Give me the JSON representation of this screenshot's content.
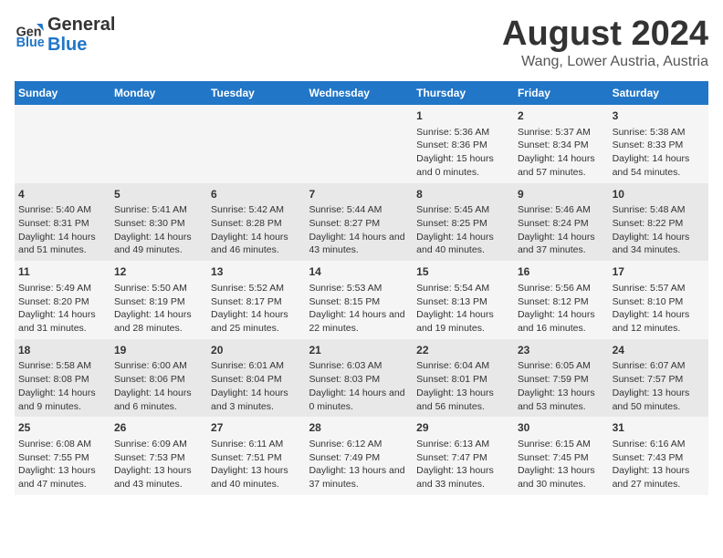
{
  "logo": {
    "line1": "General",
    "line2": "Blue"
  },
  "title": "August 2024",
  "subtitle": "Wang, Lower Austria, Austria",
  "days_of_week": [
    "Sunday",
    "Monday",
    "Tuesday",
    "Wednesday",
    "Thursday",
    "Friday",
    "Saturday"
  ],
  "weeks": [
    [
      {
        "day": "",
        "detail": ""
      },
      {
        "day": "",
        "detail": ""
      },
      {
        "day": "",
        "detail": ""
      },
      {
        "day": "",
        "detail": ""
      },
      {
        "day": "1",
        "detail": "Sunrise: 5:36 AM\nSunset: 8:36 PM\nDaylight: 15 hours and 0 minutes."
      },
      {
        "day": "2",
        "detail": "Sunrise: 5:37 AM\nSunset: 8:34 PM\nDaylight: 14 hours and 57 minutes."
      },
      {
        "day": "3",
        "detail": "Sunrise: 5:38 AM\nSunset: 8:33 PM\nDaylight: 14 hours and 54 minutes."
      }
    ],
    [
      {
        "day": "4",
        "detail": "Sunrise: 5:40 AM\nSunset: 8:31 PM\nDaylight: 14 hours and 51 minutes."
      },
      {
        "day": "5",
        "detail": "Sunrise: 5:41 AM\nSunset: 8:30 PM\nDaylight: 14 hours and 49 minutes."
      },
      {
        "day": "6",
        "detail": "Sunrise: 5:42 AM\nSunset: 8:28 PM\nDaylight: 14 hours and 46 minutes."
      },
      {
        "day": "7",
        "detail": "Sunrise: 5:44 AM\nSunset: 8:27 PM\nDaylight: 14 hours and 43 minutes."
      },
      {
        "day": "8",
        "detail": "Sunrise: 5:45 AM\nSunset: 8:25 PM\nDaylight: 14 hours and 40 minutes."
      },
      {
        "day": "9",
        "detail": "Sunrise: 5:46 AM\nSunset: 8:24 PM\nDaylight: 14 hours and 37 minutes."
      },
      {
        "day": "10",
        "detail": "Sunrise: 5:48 AM\nSunset: 8:22 PM\nDaylight: 14 hours and 34 minutes."
      }
    ],
    [
      {
        "day": "11",
        "detail": "Sunrise: 5:49 AM\nSunset: 8:20 PM\nDaylight: 14 hours and 31 minutes."
      },
      {
        "day": "12",
        "detail": "Sunrise: 5:50 AM\nSunset: 8:19 PM\nDaylight: 14 hours and 28 minutes."
      },
      {
        "day": "13",
        "detail": "Sunrise: 5:52 AM\nSunset: 8:17 PM\nDaylight: 14 hours and 25 minutes."
      },
      {
        "day": "14",
        "detail": "Sunrise: 5:53 AM\nSunset: 8:15 PM\nDaylight: 14 hours and 22 minutes."
      },
      {
        "day": "15",
        "detail": "Sunrise: 5:54 AM\nSunset: 8:13 PM\nDaylight: 14 hours and 19 minutes."
      },
      {
        "day": "16",
        "detail": "Sunrise: 5:56 AM\nSunset: 8:12 PM\nDaylight: 14 hours and 16 minutes."
      },
      {
        "day": "17",
        "detail": "Sunrise: 5:57 AM\nSunset: 8:10 PM\nDaylight: 14 hours and 12 minutes."
      }
    ],
    [
      {
        "day": "18",
        "detail": "Sunrise: 5:58 AM\nSunset: 8:08 PM\nDaylight: 14 hours and 9 minutes."
      },
      {
        "day": "19",
        "detail": "Sunrise: 6:00 AM\nSunset: 8:06 PM\nDaylight: 14 hours and 6 minutes."
      },
      {
        "day": "20",
        "detail": "Sunrise: 6:01 AM\nSunset: 8:04 PM\nDaylight: 14 hours and 3 minutes."
      },
      {
        "day": "21",
        "detail": "Sunrise: 6:03 AM\nSunset: 8:03 PM\nDaylight: 14 hours and 0 minutes."
      },
      {
        "day": "22",
        "detail": "Sunrise: 6:04 AM\nSunset: 8:01 PM\nDaylight: 13 hours and 56 minutes."
      },
      {
        "day": "23",
        "detail": "Sunrise: 6:05 AM\nSunset: 7:59 PM\nDaylight: 13 hours and 53 minutes."
      },
      {
        "day": "24",
        "detail": "Sunrise: 6:07 AM\nSunset: 7:57 PM\nDaylight: 13 hours and 50 minutes."
      }
    ],
    [
      {
        "day": "25",
        "detail": "Sunrise: 6:08 AM\nSunset: 7:55 PM\nDaylight: 13 hours and 47 minutes."
      },
      {
        "day": "26",
        "detail": "Sunrise: 6:09 AM\nSunset: 7:53 PM\nDaylight: 13 hours and 43 minutes."
      },
      {
        "day": "27",
        "detail": "Sunrise: 6:11 AM\nSunset: 7:51 PM\nDaylight: 13 hours and 40 minutes."
      },
      {
        "day": "28",
        "detail": "Sunrise: 6:12 AM\nSunset: 7:49 PM\nDaylight: 13 hours and 37 minutes."
      },
      {
        "day": "29",
        "detail": "Sunrise: 6:13 AM\nSunset: 7:47 PM\nDaylight: 13 hours and 33 minutes."
      },
      {
        "day": "30",
        "detail": "Sunrise: 6:15 AM\nSunset: 7:45 PM\nDaylight: 13 hours and 30 minutes."
      },
      {
        "day": "31",
        "detail": "Sunrise: 6:16 AM\nSunset: 7:43 PM\nDaylight: 13 hours and 27 minutes."
      }
    ]
  ]
}
